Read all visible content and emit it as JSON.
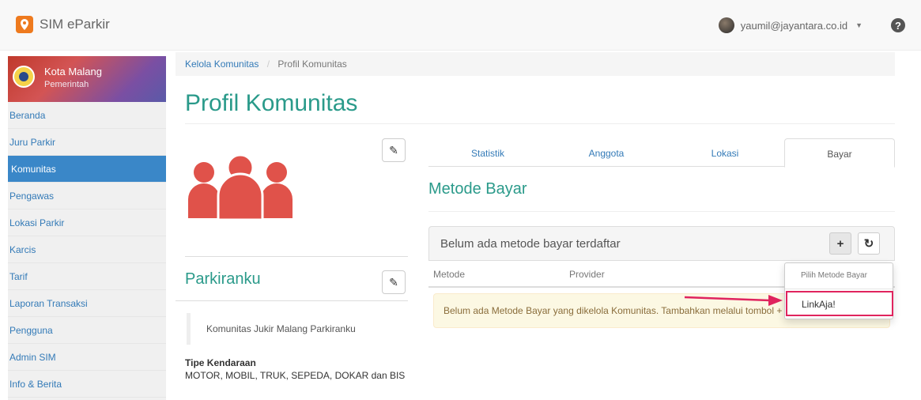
{
  "app": {
    "title": "SIM eParkir"
  },
  "header": {
    "user_email": "yaumil@jayantara.co.id",
    "help_glyph": "?"
  },
  "sidebar": {
    "org": {
      "name": "Kota Malang",
      "subtitle": "Pemerintah"
    },
    "items": [
      {
        "label": "Beranda"
      },
      {
        "label": "Juru Parkir"
      },
      {
        "label": "Komunitas",
        "active": true
      },
      {
        "label": "Pengawas"
      },
      {
        "label": "Lokasi Parkir"
      },
      {
        "label": "Karcis"
      },
      {
        "label": "Tarif"
      },
      {
        "label": "Laporan Transaksi"
      },
      {
        "label": "Pengguna"
      },
      {
        "label": "Admin SIM"
      },
      {
        "label": "Info & Berita"
      }
    ]
  },
  "breadcrumb": {
    "parent": "Kelola Komunitas",
    "separator": "/",
    "current": "Profil Komunitas"
  },
  "page": {
    "title": "Profil Komunitas"
  },
  "community": {
    "name": "Parkiranku",
    "description": "Komunitas Jukir Malang Parkiranku",
    "vehicle_type_label": "Tipe Kendaraan",
    "vehicle_types": "MOTOR, MOBIL, TRUK, SEPEDA, DOKAR dan BIS"
  },
  "tabs": [
    {
      "label": "Statistik"
    },
    {
      "label": "Anggota"
    },
    {
      "label": "Lokasi"
    },
    {
      "label": "Bayar",
      "active": true
    }
  ],
  "payment": {
    "section_title": "Metode Bayar",
    "panel_text": "Belum ada metode bayar terdaftar",
    "columns": [
      "Metode",
      "Provider"
    ],
    "alert_text": "Belum ada Metode Bayar yang dikelola Komunitas. Tambahkan melalui tombol +",
    "add_glyph": "+",
    "refresh_glyph": "↻",
    "dropdown": {
      "header": "Pilih Metode Bayar",
      "items": [
        "LinkAja!"
      ]
    }
  },
  "colors": {
    "accent": "#2a9a8a",
    "link": "#337ab7",
    "active_nav": "#3a87c8",
    "people_icon": "#e0524a",
    "highlight": "#e0245e"
  },
  "icons": [
    "map-pin-logo-icon",
    "avatar",
    "help-icon",
    "edit-icon",
    "people-icon",
    "plus-icon",
    "refresh-icon",
    "arrow-icon"
  ]
}
